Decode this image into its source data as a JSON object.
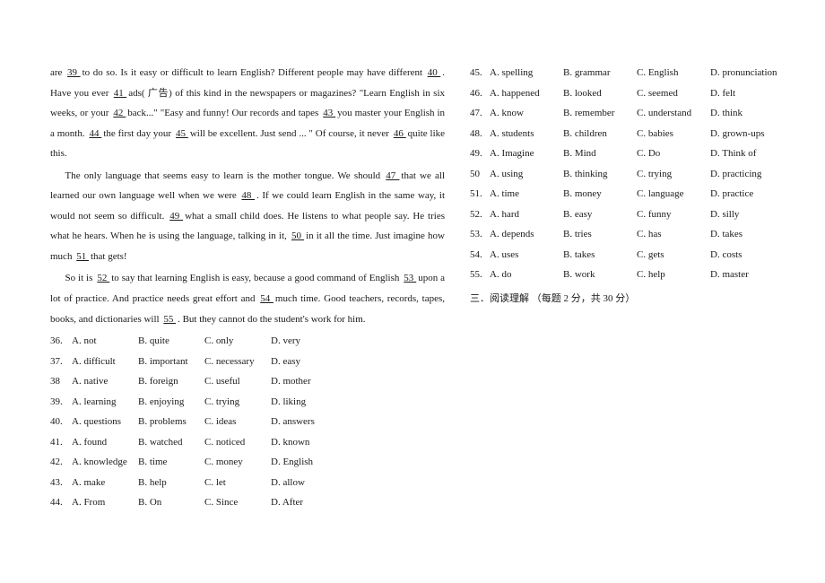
{
  "passage": {
    "p1_a": "are ",
    "b39": " 39 ",
    "p1_b": " to do so.   Is it easy or difficult to learn English? Different people may have different ",
    "b40": "40 ",
    "p1_c": ". Have you ever ",
    "b41": " 41 ",
    "p1_d": " ads( 广告) of this kind in the newspapers or magazines? \"Learn English in six weeks, or your ",
    "b42": " 42 ",
    "p1_e": " back...\" \"Easy and funny! Our records and tapes ",
    "b43": " 43 ",
    "p1_f": " you master your English in a month. ",
    "b44": " 44 ",
    "p1_g": " the first day your ",
    "b45": " 45 ",
    "p1_h": " will be excellent. Just send ... \"  Of course, it never ",
    "b46": " 46 ",
    "p1_i": " quite like this.",
    "p2_a": "The only language that seems easy to learn is the mother tongue. We should ",
    "b47": " 47 ",
    "p2_b": " that we all learned our own language well when we were ",
    "b48": " 48 ",
    "p2_c": ". If we could learn English in the same  way, it would not seem so difficult. ",
    "b49": " 49 ",
    "p2_d": " what a small child  does. He listens to what people say. He tries what he hears. When he is using the language, talking in it, ",
    "b50": "50 ",
    "p2_e": " in it all  the time. Just imagine how much ",
    "b51": " 51 ",
    "p2_f": " that gets!",
    "p3_a": "So it is ",
    "b52": " 52 ",
    "p3_b": " to say that learning English is easy, because a good command of English ",
    "b53": " 53 ",
    "p3_c": " upon a lot of practice. And practice needs great effort and ",
    "b54": " 54 ",
    "p3_d": " much time. Good teachers, records, tapes, books, and dictionaries will ",
    "b55": " 55 ",
    "p3_e": " . But they cannot do the student's work for him."
  },
  "options_left": [
    {
      "n": "36.",
      "a": "A. not",
      "b": "B. quite",
      "c": "C. only",
      "d": "D. very"
    },
    {
      "n": "37.",
      "a": "A. difficult",
      "b": "B. important",
      "c": "C. necessary",
      "d": "D. easy"
    },
    {
      "n": "38",
      "a": "A. native",
      "b": "B. foreign",
      "c": "C. useful",
      "d": "D. mother"
    },
    {
      "n": "39.",
      "a": "A. learning",
      "b": "B. enjoying",
      "c": "C. trying",
      "d": "D. liking"
    },
    {
      "n": "40.",
      "a": "A. questions",
      "b": "B. problems",
      "c": "C. ideas",
      "d": "D. answers"
    },
    {
      "n": "41.",
      "a": "A. found",
      "b": "B. watched",
      "c": "C. noticed",
      "d": "D. known"
    },
    {
      "n": "42.",
      "a": "A. knowledge",
      "b": "B. time",
      "c": "C. money",
      "d": "D. English"
    },
    {
      "n": "43.",
      "a": "A. make",
      "b": "B. help",
      "c": "C. let",
      "d": "D. allow"
    },
    {
      "n": "44.",
      "a": "A. From",
      "b": "B. On",
      "c": "C. Since",
      "d": "D. After"
    }
  ],
  "options_right": [
    {
      "n": "45.",
      "a": "A. spelling",
      "b": "B. grammar",
      "c": "C. English",
      "d": "D. pronunciation"
    },
    {
      "n": "46.",
      "a": "A. happened",
      "b": "B. looked",
      "c": "C. seemed",
      "d": "D. felt"
    },
    {
      "n": "47.",
      "a": "A. know",
      "b": "B. remember",
      "c": "C. understand",
      "d": "D. think"
    },
    {
      "n": "48.",
      "a": "A. students",
      "b": "B. children",
      "c": "C. babies",
      "d": "D. grown-ups"
    },
    {
      "n": "49.",
      "a": "A. Imagine",
      "b": "B. Mind",
      "c": "C. Do",
      "d": "D. Think of"
    },
    {
      "n": "50",
      "a": "A. using",
      "b": "B. thinking",
      "c": "C. trying",
      "d": "D. practicing"
    },
    {
      "n": "51.",
      "a": "A. time",
      "b": "B. money",
      "c": "C. language",
      "d": "D. practice"
    },
    {
      "n": "52.",
      "a": "A. hard",
      "b": "B. easy",
      "c": "C. funny",
      "d": "D. silly"
    },
    {
      "n": "53.",
      "a": "A. depends",
      "b": "B. tries",
      "c": "C. has",
      "d": "D. takes"
    },
    {
      "n": "54.",
      "a": "A. uses",
      "b": "B. takes",
      "c": "C. gets",
      "d": "D. costs"
    },
    {
      "n": "55.",
      "a": "A. do",
      "b": "B. work",
      "c": "C. help",
      "d": "D. master"
    }
  ],
  "section3": "三．阅读理解 （每题 2 分，共 30 分）"
}
